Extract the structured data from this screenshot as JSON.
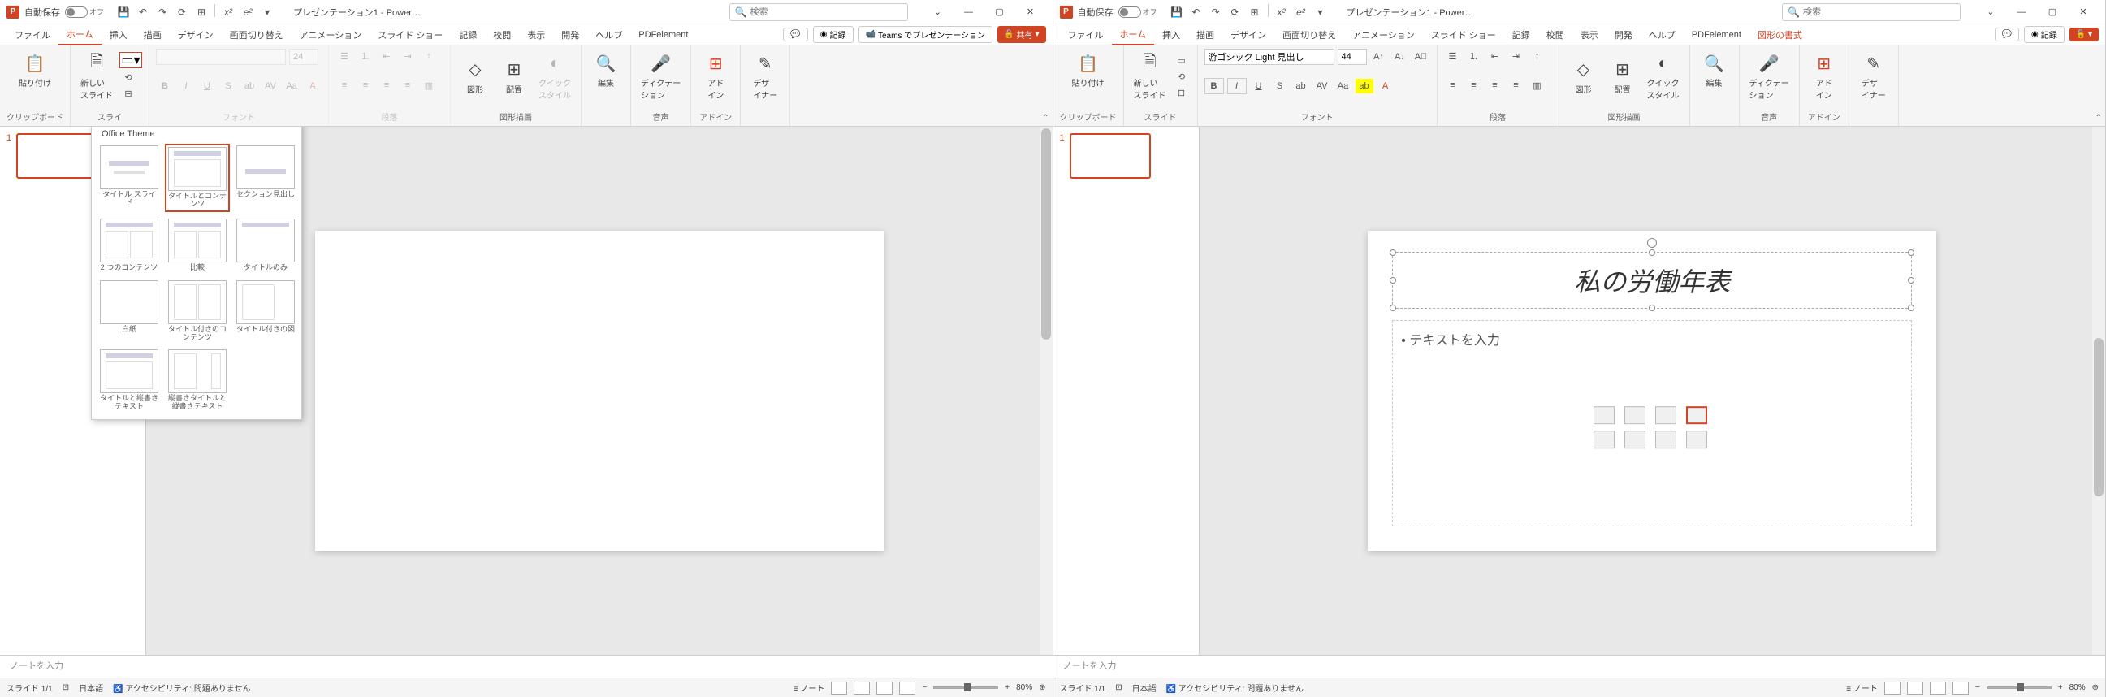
{
  "title": {
    "autosave": "自動保存",
    "off": "オフ",
    "filename": "プレゼンテーション1 - Power…",
    "search_placeholder": "検索"
  },
  "tabs": {
    "file": "ファイル",
    "home": "ホーム",
    "insert": "挿入",
    "draw": "描画",
    "design": "デザイン",
    "transitions": "画面切り替え",
    "animations": "アニメーション",
    "slideshow": "スライド ショー",
    "record": "記録",
    "review": "校閲",
    "view": "表示",
    "developer": "開発",
    "help": "ヘルプ",
    "pdf": "PDFelement",
    "format": "図形の書式",
    "record_btn": "記録",
    "teams": "Teams でプレゼンテーション",
    "share": "共有"
  },
  "ribbon": {
    "clipboard": "クリップボード",
    "paste": "貼り付け",
    "slide": "スライド",
    "slides": "スライ",
    "new_slide": "新しい\nスライド",
    "font": "フォント",
    "paragraph": "段落",
    "drawing": "図形描画",
    "shapes": "図形",
    "arrange": "配置",
    "quick": "クイック\nスタイル",
    "editing": "編集",
    "voice": "音声",
    "dictation": "ディクテー\nション",
    "addins": "アドイン",
    "addin": "アド\nイン",
    "designer": "デザ\nイナー",
    "font_name": "游ゴシック Light 見出し",
    "font_size": "44"
  },
  "layout_popup": {
    "header": "Office Theme",
    "items": [
      "タイトル スライド",
      "タイトルとコンテンツ",
      "セクション見出し",
      "2 つのコンテンツ",
      "比較",
      "タイトルのみ",
      "白紙",
      "タイトル付きのコンテンツ",
      "タイトル付きの図",
      "タイトルと縦書きテキスト",
      "縦書きタイトルと縦書きテキスト"
    ]
  },
  "slide": {
    "title_text": "私の労働年表",
    "content_placeholder": "• テキストを入力",
    "num": "1"
  },
  "notes": "ノートを入力",
  "status": {
    "slide": "スライド 1/1",
    "lang": "日本語",
    "acc": "アクセシビリティ: 問題ありません",
    "notes_btn": "ノート",
    "zoom": "80%"
  }
}
